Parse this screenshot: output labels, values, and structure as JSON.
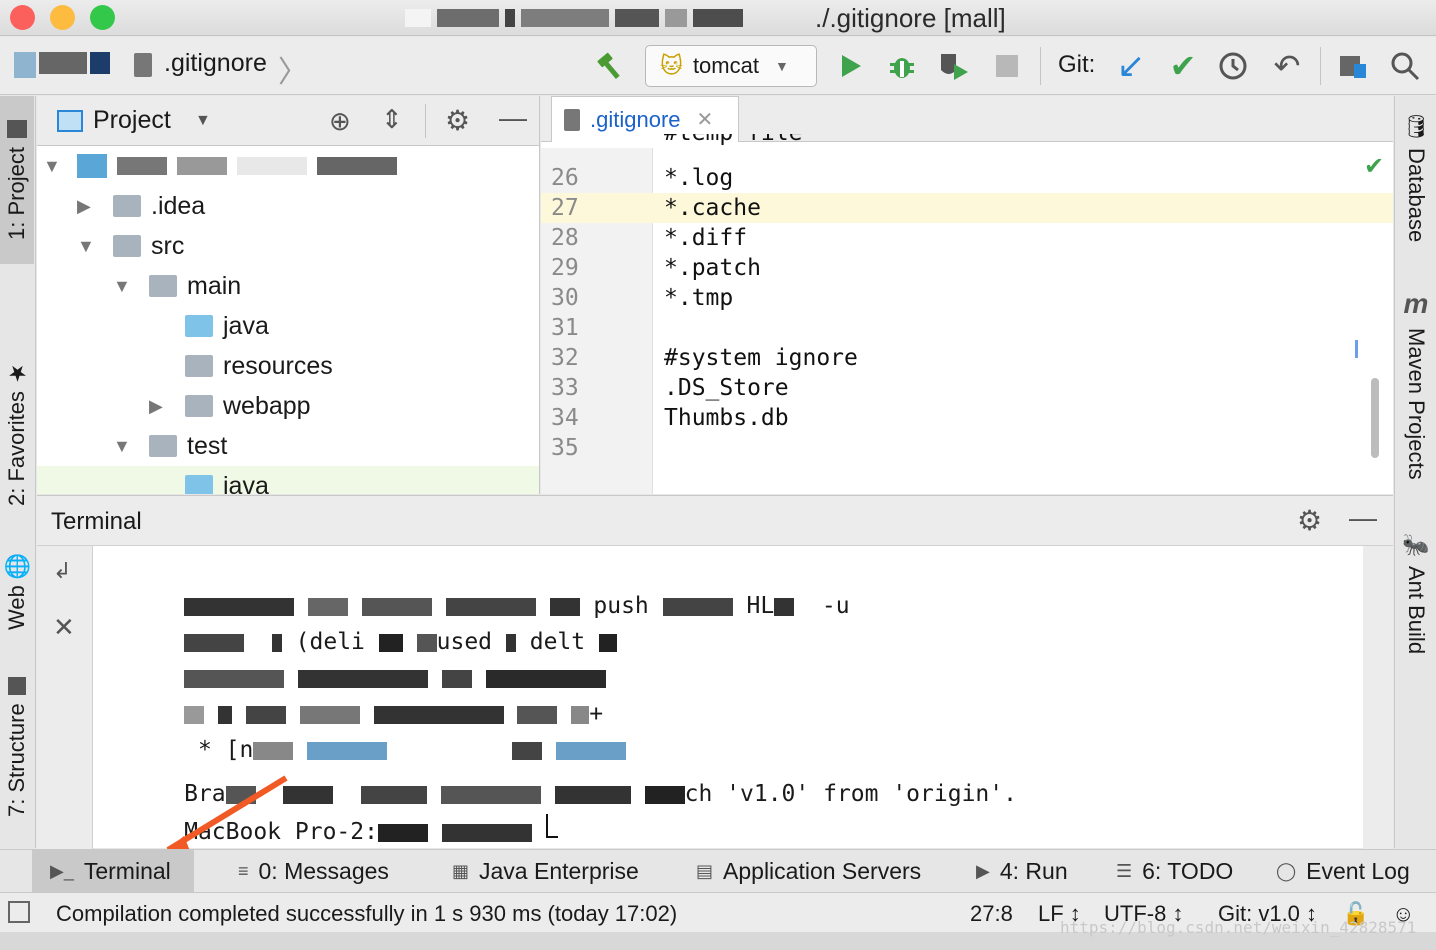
{
  "window": {
    "title": "./.gitignore [mall]",
    "colors": {
      "close": "#fc605c",
      "minimize": "#fdbc40",
      "maximize": "#34c84a"
    }
  },
  "toolbar": {
    "breadcrumb_file": ".gitignore",
    "run_config": "tomcat",
    "git_label": "Git:",
    "icons": [
      "build-hammer-icon",
      "run-icon",
      "debug-icon",
      "coverage-icon",
      "stop-icon",
      "git-update-icon",
      "git-commit-icon",
      "history-icon",
      "revert-icon",
      "project-structure-icon",
      "search-icon"
    ]
  },
  "left_stripe": {
    "tabs": [
      "1: Project",
      "2: Favorites",
      "Web",
      "7: Structure"
    ]
  },
  "right_stripe": {
    "tabs": [
      "Database",
      "Maven Projects",
      "Ant Build"
    ]
  },
  "project": {
    "title": "Project",
    "tree": [
      {
        "label": ".idea",
        "level": 1,
        "arrow": "right"
      },
      {
        "label": "src",
        "level": 1,
        "arrow": "down"
      },
      {
        "label": "main",
        "level": 2,
        "arrow": "down"
      },
      {
        "label": "java",
        "level": 3,
        "arrow": "",
        "blue": true
      },
      {
        "label": "resources",
        "level": 3,
        "arrow": ""
      },
      {
        "label": "webapp",
        "level": 3,
        "arrow": "right"
      },
      {
        "label": "test",
        "level": 2,
        "arrow": "down"
      },
      {
        "label": "java",
        "level": 3,
        "arrow": "",
        "blue": true
      }
    ]
  },
  "editor": {
    "tab_label": ".gitignore",
    "partial_top": "#temp file",
    "lines": [
      {
        "n": "26",
        "code": "*.log"
      },
      {
        "n": "27",
        "code": "*.cache"
      },
      {
        "n": "28",
        "code": "*.diff"
      },
      {
        "n": "29",
        "code": "*.patch"
      },
      {
        "n": "30",
        "code": "*.tmp"
      },
      {
        "n": "31",
        "code": ""
      },
      {
        "n": "32",
        "code": "#system ignore"
      },
      {
        "n": "33",
        "code": ".DS_Store"
      },
      {
        "n": "34",
        "code": "Thumbs.db"
      },
      {
        "n": "35",
        "code": ""
      }
    ],
    "highlight_line": "27"
  },
  "terminal": {
    "title": "Terminal",
    "lines": [
      {
        "a": "",
        "b": "push",
        "c": "HL",
        "d": "-u"
      },
      {
        "a": "(deli",
        "b": "used",
        "c": "delt",
        "d": ""
      },
      {
        "a": "",
        "b": "",
        "c": "",
        "d": ""
      },
      {
        "a": "",
        "b": "",
        "c": "",
        "d": "+"
      },
      {
        "a": " * [n",
        "b": "",
        "c": "",
        "d": ""
      },
      {
        "a": "Bra",
        "b": "",
        "c": "ch 'v1.0' from 'origin'.",
        "d": ""
      },
      {
        "a": "MacBook Pro-2:",
        "b": "",
        "c": "",
        "d": ""
      }
    ]
  },
  "bottom_tabs": [
    {
      "label": "Terminal",
      "active": true,
      "icon": "terminal-icon"
    },
    {
      "label": "0: Messages",
      "active": false,
      "icon": "messages-icon"
    },
    {
      "label": "Java Enterprise",
      "active": false,
      "icon": "java-enterprise-icon"
    },
    {
      "label": "Application Servers",
      "active": false,
      "icon": "servers-icon"
    },
    {
      "label": "4: Run",
      "active": false,
      "icon": "run-tab-icon"
    },
    {
      "label": "6: TODO",
      "active": false,
      "icon": "todo-icon"
    },
    {
      "label": "Event Log",
      "active": false,
      "icon": "event-log-icon"
    }
  ],
  "status": {
    "message": "Compilation completed successfully in 1 s 930 ms (today 17:02)",
    "position": "27:8",
    "line_sep": "LF ↕",
    "encoding": "UTF-8 ↕",
    "git_branch": "Git: v1.0 ↕"
  },
  "watermark": "https://blog.csdn.net/weixin_42828571"
}
